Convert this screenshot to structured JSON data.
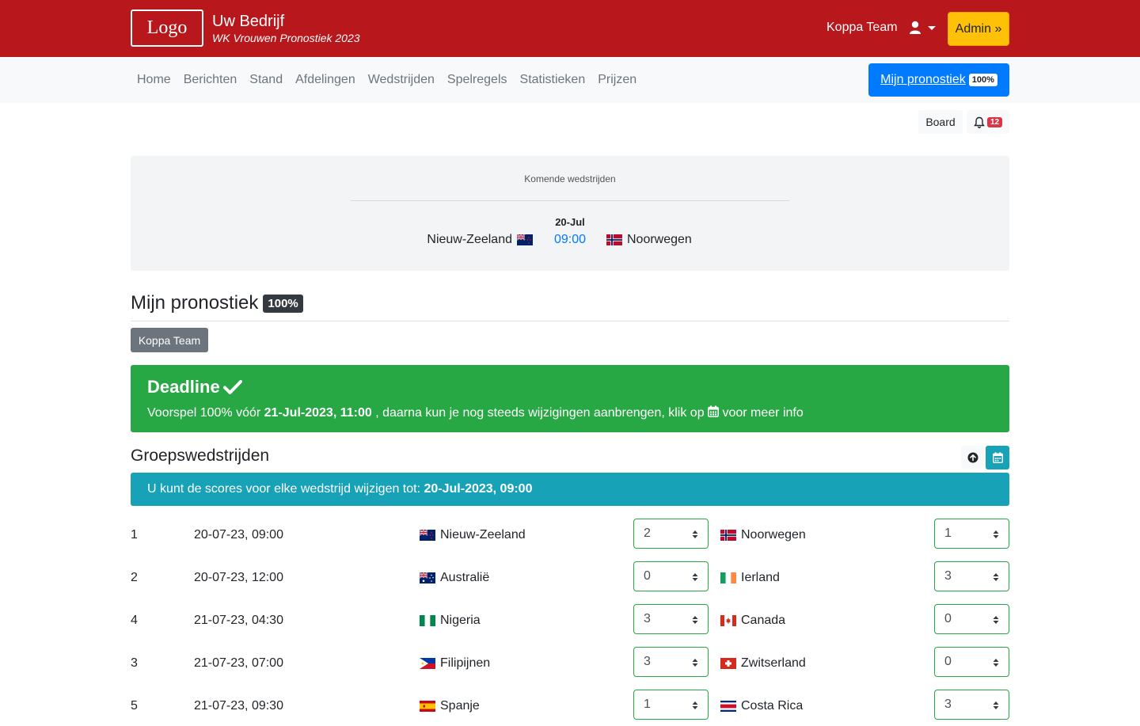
{
  "header": {
    "logo_text": "Logo",
    "company": "Uw Bedrijf",
    "subtitle": "WK Vrouwen Pronostiek 2023",
    "user_name": "Koppa Team",
    "admin_label": "Admin »"
  },
  "nav": {
    "items": [
      "Home",
      "Berichten",
      "Stand",
      "Afdelingen",
      "Wedstrijden",
      "Spelregels",
      "Statistieken",
      "Prijzen"
    ],
    "mijn_label": "Mijn pronostiek",
    "mijn_badge": "100%"
  },
  "toolbar": {
    "board_label": "Board",
    "notification_count": "12"
  },
  "upcoming": {
    "title": "Komende wedstrijden",
    "date": "20-Jul",
    "home": "Nieuw-Zeeland",
    "home_flag": "nz",
    "time": "09:00",
    "away": "Noorwegen",
    "away_flag": "no"
  },
  "mijn": {
    "title": "Mijn pronostiek",
    "badge": "100%",
    "team_button": "Koppa Team"
  },
  "deadline": {
    "title": "Deadline",
    "text_before": "Voorspel 100% vóór ",
    "date": "21-Jul-2023, 11:00",
    "text_after": " , daarna kun je nog steeds wijzigingen aanbrengen, klik op ",
    "text_end": " voor meer info"
  },
  "groep": {
    "title": "Groepswedstrijden",
    "info_before": "U kunt de scores voor elke wedstrijd wijzigen tot: ",
    "info_date": "20-Jul-2023, 09:00"
  },
  "matches": [
    {
      "num": "1",
      "datetime": "20-07-23, 09:00",
      "home": "Nieuw-Zeeland",
      "home_flag": "nz",
      "home_score": "2",
      "away": "Noorwegen",
      "away_flag": "no",
      "away_score": "1"
    },
    {
      "num": "2",
      "datetime": "20-07-23, 12:00",
      "home": "Australië",
      "home_flag": "au",
      "home_score": "0",
      "away": "Ierland",
      "away_flag": "ie",
      "away_score": "3"
    },
    {
      "num": "4",
      "datetime": "21-07-23, 04:30",
      "home": "Nigeria",
      "home_flag": "ng",
      "home_score": "3",
      "away": "Canada",
      "away_flag": "ca",
      "away_score": "0"
    },
    {
      "num": "3",
      "datetime": "21-07-23, 07:00",
      "home": "Filipijnen",
      "home_flag": "ph",
      "home_score": "3",
      "away": "Zwitserland",
      "away_flag": "ch",
      "away_score": "0"
    },
    {
      "num": "5",
      "datetime": "21-07-23, 09:30",
      "home": "Spanje",
      "home_flag": "es",
      "home_score": "1",
      "away": "Costa Rica",
      "away_flag": "cr",
      "away_score": "3"
    }
  ],
  "colors": {
    "header_red": "#b8171b",
    "admin_yellow": "#ffc107",
    "primary_blue": "#007bff",
    "success_green": "#28a745",
    "info_teal": "#17a2b8"
  }
}
